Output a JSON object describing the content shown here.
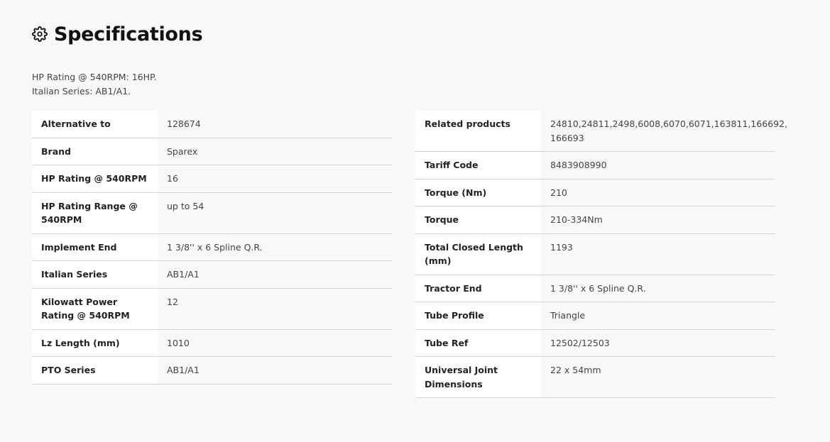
{
  "header": {
    "title": "Specifications",
    "icon": "gear-icon"
  },
  "intro": {
    "line1": "HP Rating @ 540RPM: 16HP.",
    "line2": "Italian Series: AB1/A1."
  },
  "left_table": [
    {
      "label": "Alternative to",
      "value": "128674"
    },
    {
      "label": "Brand",
      "value": "Sparex"
    },
    {
      "label": "HP Rating @ 540RPM",
      "value": "16"
    },
    {
      "label": "HP Rating Range @ 540RPM",
      "value": "up to 54"
    },
    {
      "label": "Implement End",
      "value": "1 3/8'' x 6 Spline Q.R."
    },
    {
      "label": "Italian Series",
      "value": "AB1/A1"
    },
    {
      "label": "Kilowatt Power Rating @ 540RPM",
      "value": "12"
    },
    {
      "label": "Lz Length (mm)",
      "value": "1010"
    },
    {
      "label": "PTO Series",
      "value": "AB1/A1"
    }
  ],
  "right_table": [
    {
      "label": "Related products",
      "value": "24810,24811,2498,6008,6070,6071,163811,166692, 166693"
    },
    {
      "label": "Tariff Code",
      "value": "8483908990"
    },
    {
      "label": "Torque (Nm)",
      "value": "210"
    },
    {
      "label": "Torque",
      "value": "210-334Nm"
    },
    {
      "label": "Total Closed Length (mm)",
      "value": "1193"
    },
    {
      "label": "Tractor End",
      "value": "1 3/8'' x 6 Spline Q.R."
    },
    {
      "label": "Tube Profile",
      "value": "Triangle"
    },
    {
      "label": "Tube Ref",
      "value": "12502/12503"
    },
    {
      "label": "Universal Joint Dimensions",
      "value": "22 x 54mm"
    }
  ]
}
